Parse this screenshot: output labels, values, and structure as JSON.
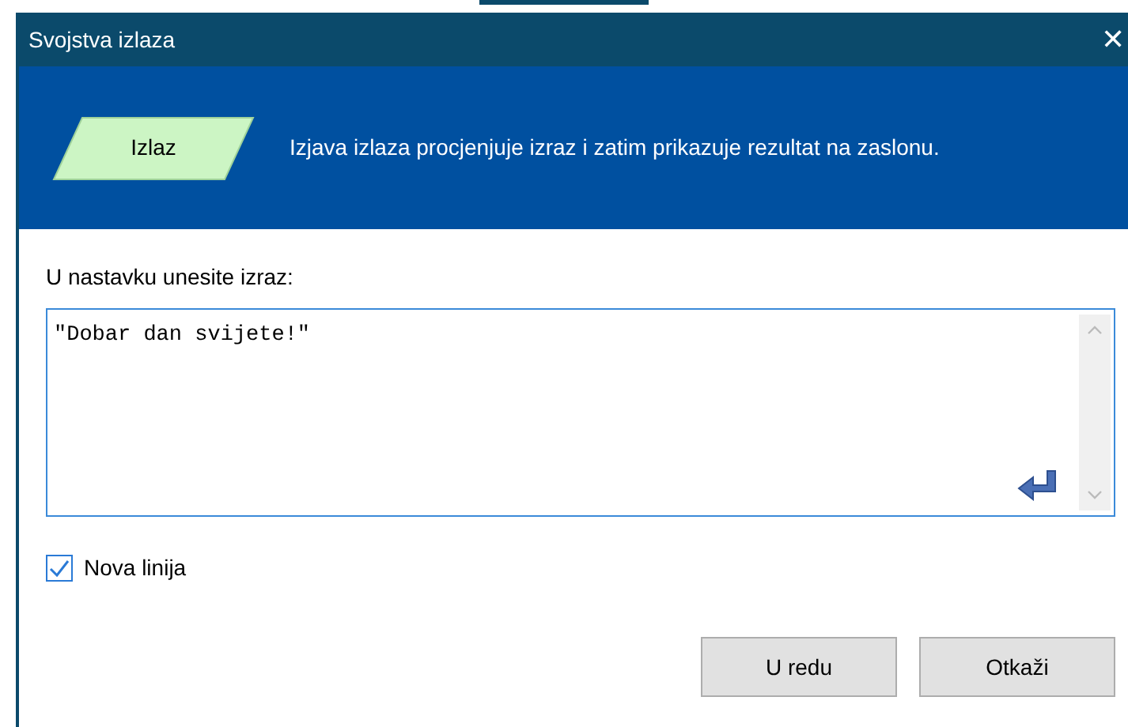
{
  "window": {
    "title": "Svojstva izlaza",
    "close": "✕"
  },
  "header": {
    "shape_label": "Izlaz",
    "description": "Izjava izlaza procjenjuje izraz i zatim prikazuje rezultat na zaslonu."
  },
  "prompt": {
    "label": "U nastavku unesite izraz:"
  },
  "expression": {
    "value": "\"Dobar dan svijete!\""
  },
  "new_line": {
    "label": "Nova linija",
    "checked": true
  },
  "buttons": [
    {
      "label": "U redu"
    },
    {
      "label": "Otkaži"
    }
  ]
}
